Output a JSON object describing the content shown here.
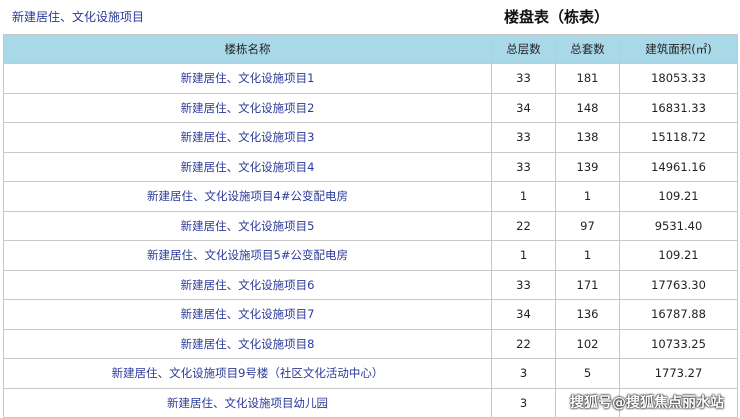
{
  "header": {
    "project_name": "新建居住、文化设施项目",
    "table_title": "楼盘表（栋表）"
  },
  "table": {
    "columns": [
      "楼栋名称",
      "总层数",
      "总套数",
      "建筑面积(㎡)"
    ],
    "rows": [
      [
        "新建居住、文化设施项目1",
        "33",
        "181",
        "18053.33"
      ],
      [
        "新建居住、文化设施项目2",
        "34",
        "148",
        "16831.33"
      ],
      [
        "新建居住、文化设施项目3",
        "33",
        "138",
        "15118.72"
      ],
      [
        "新建居住、文化设施项目4",
        "33",
        "139",
        "14961.16"
      ],
      [
        "新建居住、文化设施项目4#公变配电房",
        "1",
        "1",
        "109.21"
      ],
      [
        "新建居住、文化设施项目5",
        "22",
        "97",
        "9531.40"
      ],
      [
        "新建居住、文化设施项目5#公变配电房",
        "1",
        "1",
        "109.21"
      ],
      [
        "新建居住、文化设施项目6",
        "33",
        "171",
        "17763.30"
      ],
      [
        "新建居住、文化设施项目7",
        "34",
        "136",
        "16787.88"
      ],
      [
        "新建居住、文化设施项目8",
        "22",
        "102",
        "10733.25"
      ],
      [
        "新建居住、文化设施项目9号楼（社区文化活动中心）",
        "3",
        "5",
        "1773.27"
      ],
      [
        "新建居住、文化设施项目幼儿园",
        "3",
        "",
        ""
      ]
    ]
  },
  "watermark": "搜狐号@搜狐焦点丽水站"
}
